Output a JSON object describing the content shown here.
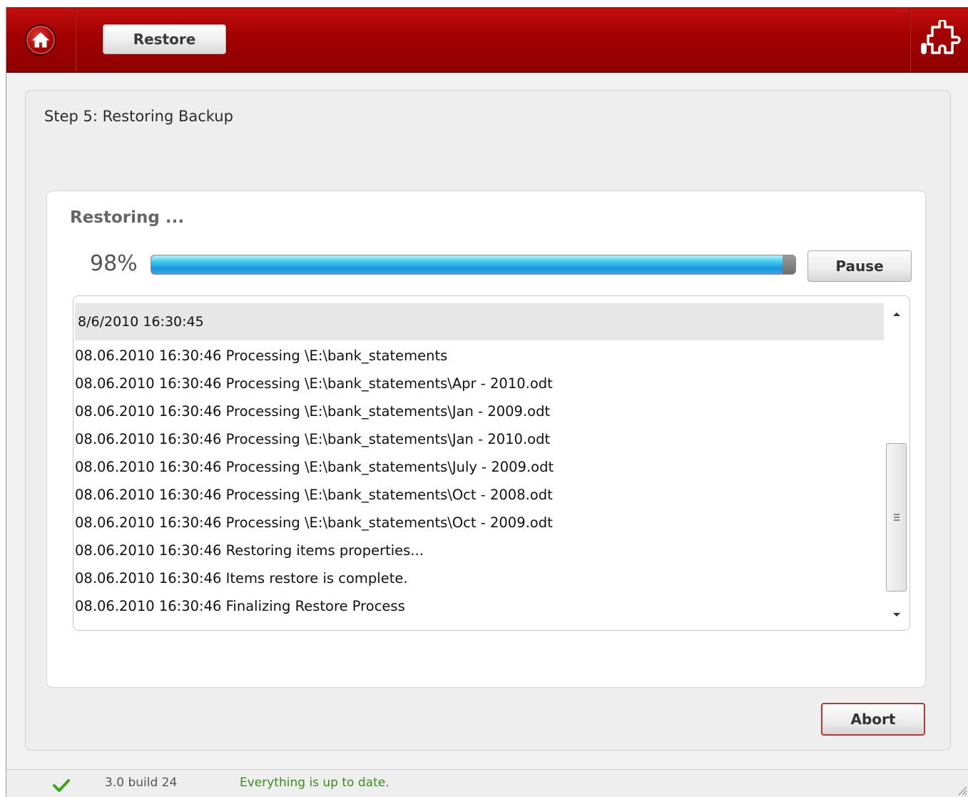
{
  "header": {
    "home_icon": "home-icon",
    "restore_button_label": "Restore",
    "logo_icon": "puzzle-logo-icon",
    "accent_color": "#a30000"
  },
  "step": {
    "title": "Step 5: Restoring Backup"
  },
  "progress": {
    "label": "Restoring ...",
    "percent_text": "98%",
    "percent_value": 98,
    "pause_button_label": "Pause"
  },
  "log": {
    "header": "8/6/2010 16:30:45",
    "lines": [
      "08.06.2010 16:30:46 Processing \\E:\\bank_statements",
      "08.06.2010 16:30:46 Processing \\E:\\bank_statements\\Apr - 2010.odt",
      "08.06.2010 16:30:46 Processing \\E:\\bank_statements\\Jan - 2009.odt",
      "08.06.2010 16:30:46 Processing \\E:\\bank_statements\\Jan - 2010.odt",
      "08.06.2010 16:30:46 Processing \\E:\\bank_statements\\July - 2009.odt",
      "08.06.2010 16:30:46 Processing \\E:\\bank_statements\\Oct - 2008.odt",
      "08.06.2010 16:30:46 Processing \\E:\\bank_statements\\Oct - 2009.odt",
      "08.06.2010 16:30:46 Restoring items properties...",
      "08.06.2010 16:30:46 Items restore is complete.",
      "08.06.2010 16:30:46 Finalizing Restore Process"
    ]
  },
  "footer": {
    "abort_button_label": "Abort"
  },
  "statusbar": {
    "version": "3.0 build 24",
    "message": "Everything is up to date.",
    "status_color": "#3b8a1e"
  }
}
